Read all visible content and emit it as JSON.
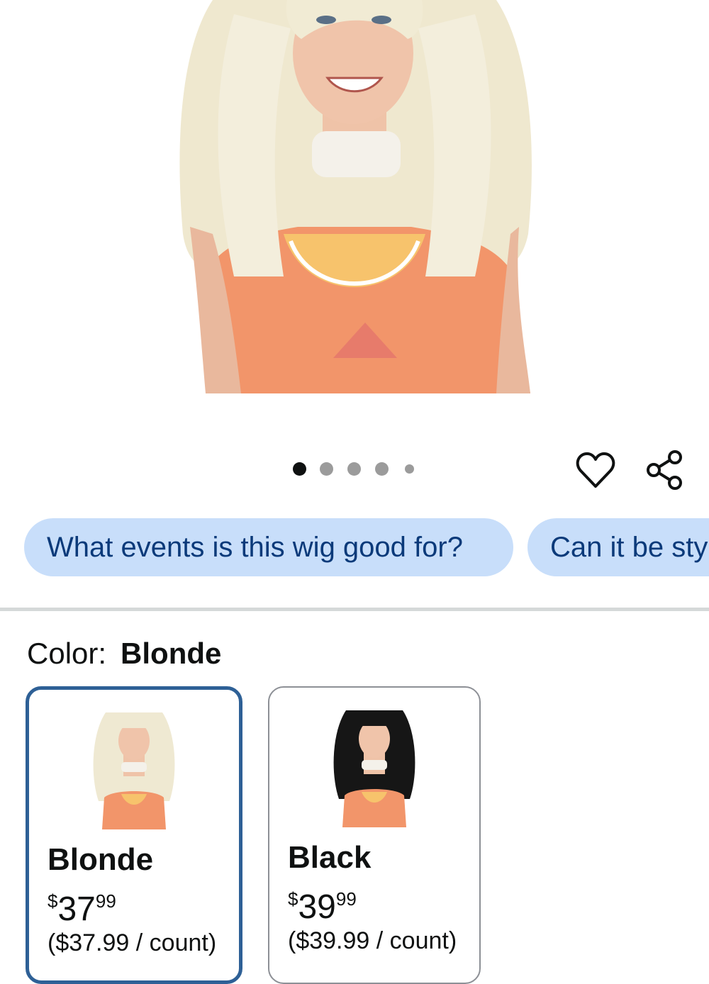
{
  "gallery": {
    "image_alt": "Woman wearing long blonde wig and orange tank top",
    "dot_count": 5,
    "active_dot": 0,
    "favorite_icon": "heart-icon",
    "share_icon": "share-icon"
  },
  "chips": [
    {
      "label": "What events is this wig good for?"
    },
    {
      "label": "Can it be sty"
    }
  ],
  "color": {
    "label": "Color:",
    "selected": "Blonde"
  },
  "swatches": [
    {
      "name": "Blonde",
      "currency": "$",
      "whole": "37",
      "cents": "99",
      "unit": "($37.99 / count)",
      "hair": "#efe9d2"
    },
    {
      "name": "Black",
      "currency": "$",
      "whole": "39",
      "cents": "99",
      "unit": "($39.99 / count)",
      "hair": "#161616"
    }
  ],
  "colors": {
    "chip_bg": "#c8defa",
    "chip_text": "#0b3a7a",
    "selected_border": "#2e6096",
    "divider": "#d5d9d9"
  }
}
